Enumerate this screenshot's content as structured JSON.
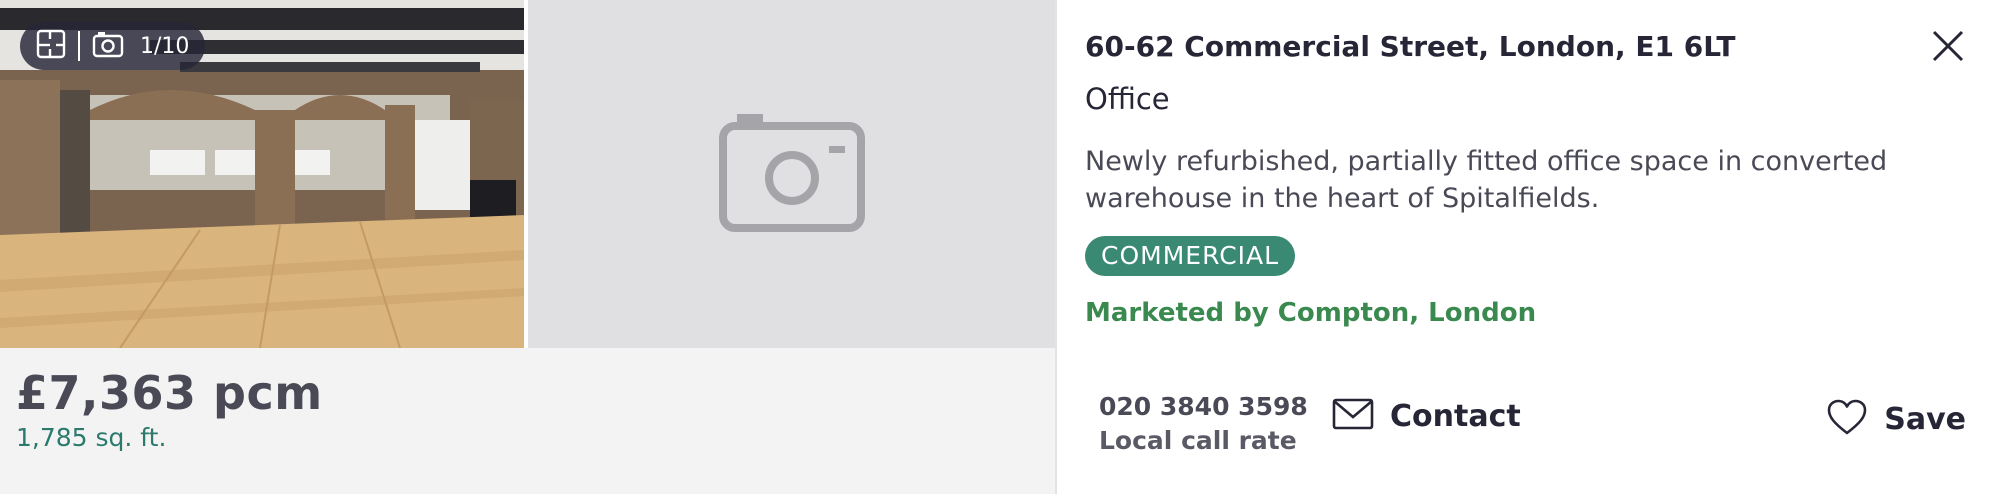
{
  "gallery": {
    "count_text": "1/10",
    "icons": [
      "floorplan-icon",
      "camera-icon"
    ],
    "placeholder_icon": "camera-icon"
  },
  "listing": {
    "price": "£7,363 pcm",
    "area": "1,785 sq. ft.",
    "address": "60-62 Commercial Street, London, E1 6LT",
    "property_type": "Office",
    "description": "Newly refurbished, partially fitted office space in converted warehouse in the heart of Spitalfields.",
    "badge": "COMMERCIAL",
    "marketed_by": "Marketed by Compton, London"
  },
  "actions": {
    "phone": "020 3840 3598",
    "call_rate": "Local call rate",
    "contact_label": "Contact",
    "save_label": "Save"
  },
  "colors": {
    "badge_bg": "#3a8a73",
    "marketed_text": "#3a8a4f",
    "area_text": "#2b7a6e"
  }
}
